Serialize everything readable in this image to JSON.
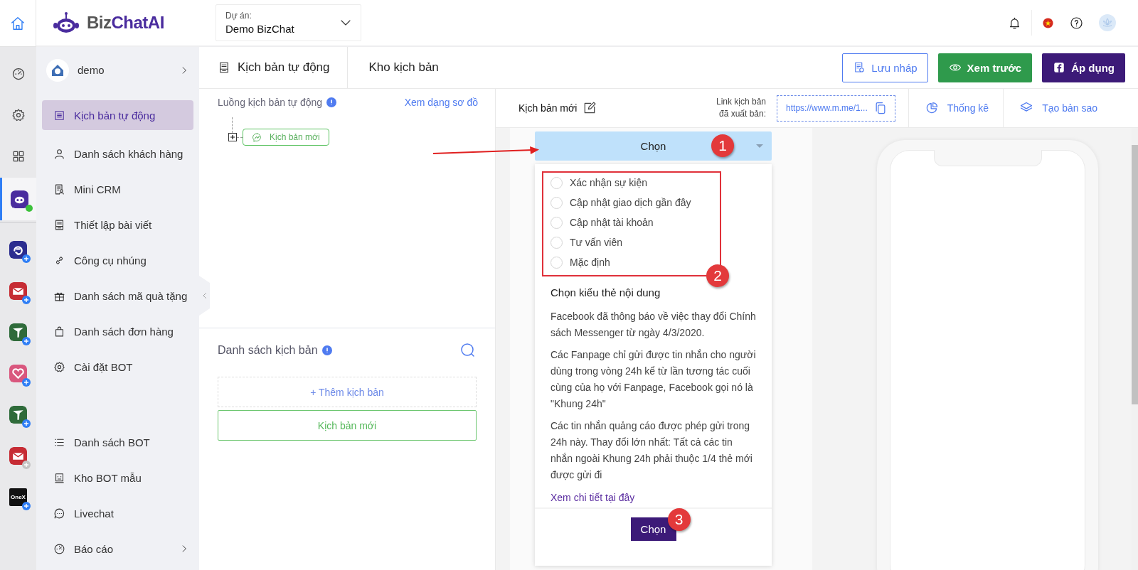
{
  "rail": {
    "home": {
      "selected": true
    },
    "tools": [
      {
        "kind": "gauge"
      },
      {
        "kind": "gear"
      },
      {
        "kind": "grid"
      }
    ],
    "apps": [
      {
        "kind": "bot",
        "color": "#4a2c9e",
        "selected": true,
        "online": true
      },
      {
        "kind": "sync",
        "color": "#2b2d8f",
        "selected": false,
        "disabled": false
      },
      {
        "kind": "mail",
        "color": "#c62c34",
        "selected": false,
        "disabled": false
      },
      {
        "kind": "tree",
        "color": "#2f6b3a",
        "selected": false,
        "disabled": false
      },
      {
        "kind": "heart",
        "color": "#d9577e",
        "selected": false,
        "disabled": false
      },
      {
        "kind": "tree",
        "color": "#2f6b3a",
        "selected": false,
        "disabled": false
      },
      {
        "kind": "mail",
        "color": "#c62c34",
        "selected": false,
        "disabled": true
      },
      {
        "kind": "onex",
        "color": "#111111",
        "label": "OneX",
        "selected": false,
        "disabled": false
      }
    ]
  },
  "header": {
    "logo": {
      "part_1": "Biz",
      "part_2": "ChatAI"
    },
    "project": {
      "label": "Dự án:",
      "value": "Demo BizChat"
    }
  },
  "sidebar": {
    "account": {
      "name": "demo"
    },
    "groups": [
      [
        {
          "kind": "list",
          "label": "Kịch bản tự động",
          "selected": true,
          "expandable": false
        },
        {
          "kind": "user",
          "label": "Danh sách khách hàng",
          "selected": false,
          "expandable": false
        },
        {
          "kind": "crm",
          "label": "Mini CRM",
          "selected": false,
          "expandable": false
        },
        {
          "kind": "doc",
          "label": "Thiết lập bài viết",
          "selected": false,
          "expandable": false
        },
        {
          "kind": "link",
          "label": "Công cụ nhúng",
          "selected": false,
          "expandable": false
        },
        {
          "kind": "gift",
          "label": "Danh sách mã quà tặng",
          "selected": false,
          "expandable": false
        },
        {
          "kind": "bag",
          "label": "Danh sách đơn hàng",
          "selected": false,
          "expandable": false
        },
        {
          "kind": "gear",
          "label": "Cài đặt BOT",
          "selected": false,
          "expandable": false
        }
      ],
      [
        {
          "kind": "lines",
          "label": "Danh sách BOT",
          "selected": false,
          "expandable": false
        },
        {
          "kind": "face",
          "label": "Kho BOT mẫu",
          "selected": false,
          "expandable": false
        },
        {
          "kind": "chat",
          "label": "Livechat",
          "selected": false,
          "expandable": false
        },
        {
          "kind": "gauge",
          "label": "Báo cáo",
          "selected": false,
          "expandable": true
        }
      ]
    ]
  },
  "breadcrumb": [
    {
      "label": "Kịch bản tự động"
    },
    {
      "label": "Kho kịch bản"
    }
  ],
  "actions": [
    {
      "kind": "draft",
      "label": "Lưu nháp"
    },
    {
      "kind": "preview",
      "label": "Xem trước"
    },
    {
      "kind": "apply",
      "label": "Áp dụng"
    }
  ],
  "flow_panel": {
    "title": "Luồng kịch bản tự động",
    "view_link": "Xem dạng sơ đồ",
    "nodes": [
      {
        "label": "Kịch bản mới"
      }
    ]
  },
  "script_list": {
    "title": "Danh sách kịch bản",
    "add_label": "+ Thêm kịch bản",
    "items": [
      {
        "label": "Kịch bản mới",
        "selected": true
      }
    ]
  },
  "editor": {
    "name": "Kịch bản mới",
    "link_label": "Link kịch bản\nđã xuất bản:",
    "link_value": "https://www.m.me/1...",
    "tools": [
      {
        "kind": "stats",
        "label": "Thống kê"
      },
      {
        "kind": "layers",
        "label": "Tạo bản sao"
      }
    ]
  },
  "dropdown": {
    "value": "Chọn",
    "badge": "1",
    "expanded": true,
    "options": [
      {
        "label": "Xác nhận sự kiện",
        "selected": false
      },
      {
        "label": "Cập nhật giao dịch gần đây",
        "selected": false
      },
      {
        "label": "Cập nhật tài khoản",
        "selected": false
      },
      {
        "label": "Tư vấn viên",
        "selected": false
      },
      {
        "label": "Mặc định",
        "selected": false
      }
    ],
    "options_badge": "2",
    "heading": "Chọn kiểu thẻ nội dung",
    "paragraphs": [
      "Facebook đã thông báo về việc thay đổi Chính sách Messenger từ ngày 4/3/2020.",
      "Các Fanpage chỉ gửi được tin nhắn cho người dùng trong vòng 24h kể từ lần tương tác cuối cùng của họ với Fanpage, Facebook gọi nó là \"Khung 24h\"",
      "Các tin nhắn quảng cáo được phép gửi trong 24h này. Thay đổi lớn nhất: Tất cả các tin nhắn ngoài Khung 24h phải thuộc 1/4 thẻ mới được gửi đi"
    ],
    "link": "Xem chi tiết tại đây",
    "button": "Chọn",
    "button_badge": "3"
  }
}
